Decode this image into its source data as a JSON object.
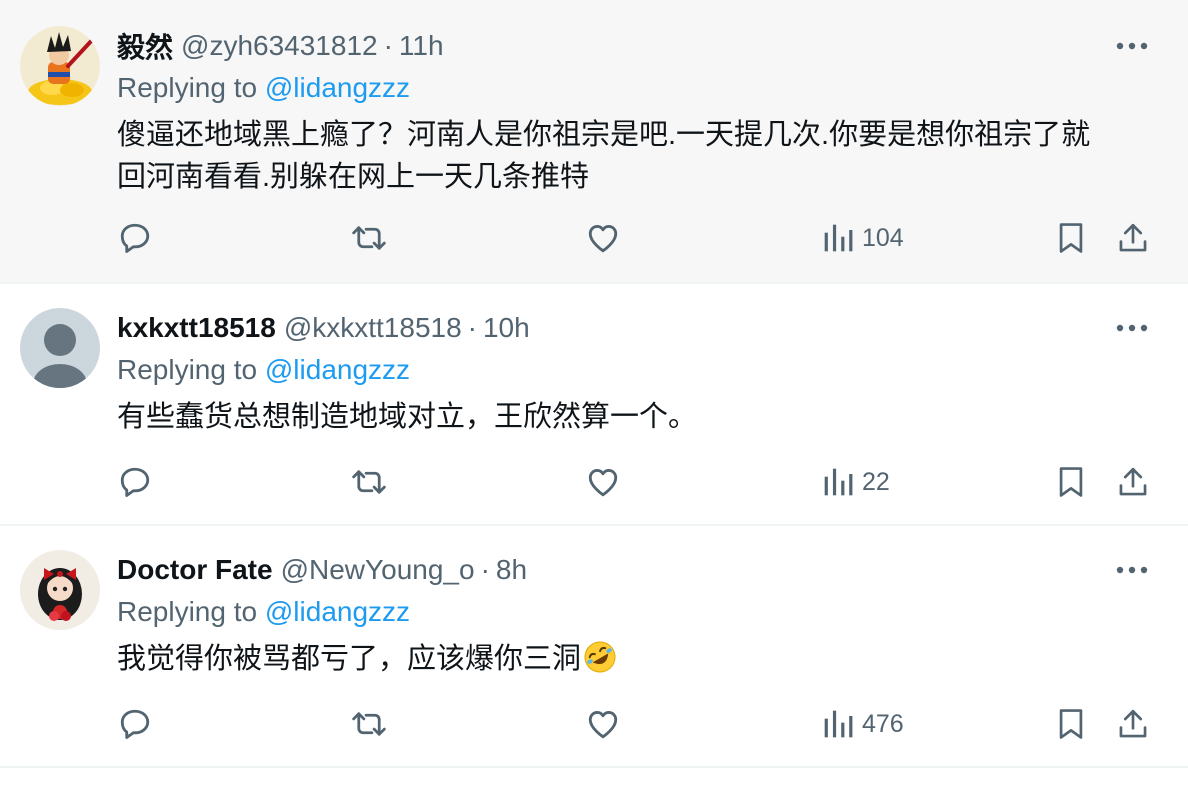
{
  "tweets": [
    {
      "name": "毅然",
      "handle": "@zyh63431812",
      "separator": "·",
      "time": "11h",
      "replying_label": "Replying to",
      "replying_to": "@lidangzzz",
      "text_lines": [
        "傻逼还地域黑上瘾了？河南人是你祖宗是吧.一天提几次.你要是想你祖宗了就",
        "回河南看看.别躲在网上一天几条推特"
      ],
      "views": "104"
    },
    {
      "name": "kxkxtt18518",
      "handle": "@kxkxtt18518",
      "separator": "·",
      "time": "10h",
      "replying_label": "Replying to",
      "replying_to": "@lidangzzz",
      "text_lines": [
        "有些蠢货总想制造地域对立，王欣然算一个。"
      ],
      "views": "22"
    },
    {
      "name": "Doctor Fate",
      "handle": "@NewYoung_o",
      "separator": "·",
      "time": "8h",
      "replying_label": "Replying to",
      "replying_to": "@lidangzzz",
      "text_lines": [
        "我觉得你被骂都亏了，应该爆你三洞"
      ],
      "emoji": "rolling-on-floor-laughing-emoji",
      "views": "476"
    }
  ],
  "icons": {
    "more": "more-horizontal-icon",
    "reply": "reply-bubble-icon",
    "retweet": "retweet-icon",
    "like": "heart-icon",
    "views": "views-bar-chart-icon",
    "bookmark": "bookmark-icon",
    "share": "share-upload-icon"
  },
  "colors": {
    "text": "#0f1419",
    "secondary": "#536471",
    "link": "#1d9bf0",
    "highlight_bg": "#f7f7f7",
    "divider": "#eff3f4"
  }
}
